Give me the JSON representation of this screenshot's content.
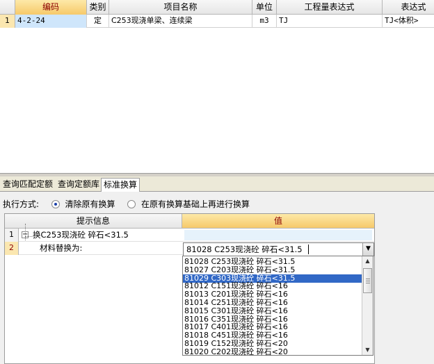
{
  "top_grid": {
    "headers": [
      "编码",
      "类别",
      "项目名称",
      "单位",
      "工程量表达式",
      "表达式"
    ],
    "rows": [
      {
        "num": "1",
        "code": "4-2-24",
        "category": "定",
        "name": "C253现浇单梁、连续梁",
        "unit": "m3",
        "qty_expr": "TJ",
        "expr": "TJ<体积>"
      }
    ]
  },
  "tabs": [
    "查询匹配定额",
    "查询定额库",
    "标准换算"
  ],
  "active_tab": "标准换算",
  "exec": {
    "label": "执行方式:",
    "option1": "清除原有换算",
    "option2": "在原有换算基础上再进行换算",
    "selected": "option1"
  },
  "lower_grid": {
    "header_info": "提示信息",
    "header_value": "值",
    "rows": [
      {
        "num": "1",
        "info": "换C253现浇砼 碎石<31.5",
        "value": ""
      },
      {
        "num": "2",
        "info": "材料替换为:",
        "value": "81028   C253现浇砼 碎石<31.5"
      }
    ]
  },
  "dropdown": {
    "items": [
      "81028   C253现浇砼 碎石<31.5",
      "81027   C203现浇砼 碎石<31.5",
      "81029   C303现浇砼 碎石<31.5",
      "81012   C151现浇砼 碎石<16",
      "81013   C201现浇砼 碎石<16",
      "81014   C251现浇砼 碎石<16",
      "81015   C301现浇砼 碎石<16",
      "81016   C351现浇砼 碎石<16",
      "81017   C401现浇砼 碎石<16",
      "81018   C451现浇砼 碎石<16",
      "81019   C152现浇砼 碎石<20",
      "81020   C202现浇砼 碎石<20"
    ],
    "highlighted_index": 2
  },
  "icons": {
    "expander": "collapse-icon",
    "combo_arrow": "chevron-down-icon",
    "scroll_up": "scroll-up-icon",
    "scroll_down": "scroll-down-icon"
  }
}
